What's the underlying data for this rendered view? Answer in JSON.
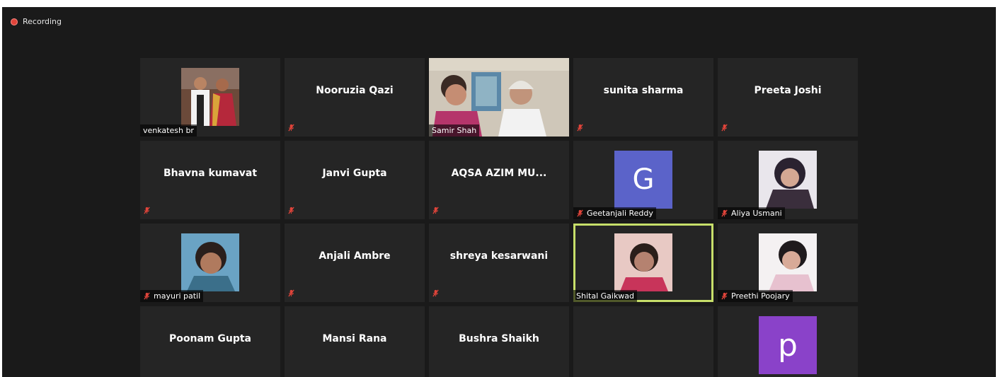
{
  "recording": {
    "label": "Recording"
  },
  "tiles": [
    {
      "id": "venkatesh",
      "label": "venkatesh br",
      "muted": false,
      "kind": "photo"
    },
    {
      "id": "nooruzia",
      "name": "Nooruzia Qazi",
      "muted": true,
      "kind": "name"
    },
    {
      "id": "samir",
      "label": "Samir Shah",
      "muted": false,
      "kind": "video"
    },
    {
      "id": "sunita",
      "name": "sunita sharma",
      "muted": true,
      "kind": "name"
    },
    {
      "id": "preeta",
      "name": "Preeta Joshi",
      "muted": true,
      "kind": "name"
    },
    {
      "id": "bhavna",
      "name": "Bhavna kumavat",
      "muted": true,
      "kind": "name"
    },
    {
      "id": "janvi",
      "name": "Janvi Gupta",
      "muted": true,
      "kind": "name"
    },
    {
      "id": "aqsa",
      "name": "AQSA AZIM MU...",
      "muted": true,
      "kind": "name"
    },
    {
      "id": "geetanjali",
      "label": "Geetanjali Reddy",
      "muted": true,
      "kind": "avatar",
      "avatar_letter": "G",
      "avatar_color": "#5b63c9"
    },
    {
      "id": "aliya",
      "label": "Aliya Usmani",
      "muted": true,
      "kind": "photo"
    },
    {
      "id": "mayuri",
      "label": "mayuri patil",
      "muted": true,
      "kind": "photo"
    },
    {
      "id": "anjali",
      "name": "Anjali Ambre",
      "muted": true,
      "kind": "name"
    },
    {
      "id": "shreya",
      "name": "shreya kesarwani",
      "muted": true,
      "kind": "name"
    },
    {
      "id": "shital",
      "label": "Shital Gaikwad",
      "muted": false,
      "kind": "photo",
      "active": true
    },
    {
      "id": "preethi",
      "label": "Preethi Poojary",
      "muted": true,
      "kind": "photo"
    },
    {
      "id": "poonam",
      "name": "Poonam Gupta",
      "muted": true,
      "kind": "name"
    },
    {
      "id": "mansi",
      "name": "Mansi Rana",
      "muted": true,
      "kind": "name"
    },
    {
      "id": "bushra",
      "name": "Bushra Shaikh",
      "muted": true,
      "kind": "name"
    },
    {
      "id": "tile19",
      "muted": true,
      "kind": "empty"
    },
    {
      "id": "tile20",
      "muted": true,
      "kind": "avatar",
      "avatar_letter": "p",
      "avatar_color": "#8a42c9"
    }
  ],
  "colors": {
    "muted_icon": "#e0443a",
    "active_border": "#c7df6a",
    "tile_bg": "#252525",
    "window_bg": "#1a1a1a"
  }
}
